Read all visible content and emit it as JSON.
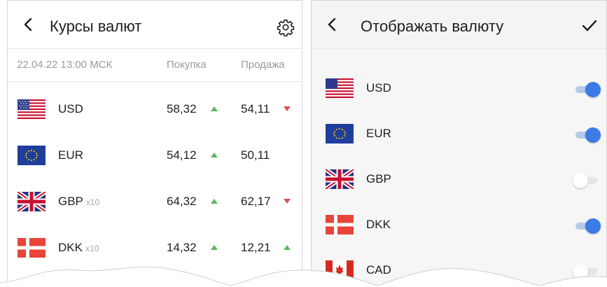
{
  "left": {
    "title": "Курсы валют",
    "date": "22.04.22 13:00 МСК",
    "col_buy": "Покупка",
    "col_sell": "Продажа",
    "back_icon": "chevron-left-icon",
    "settings_icon": "gear-icon",
    "rows": [
      {
        "code": "USD",
        "mult": "",
        "flag": "us-flag-icon",
        "buy": "58,32",
        "buy_trend": "up",
        "sell": "54,11",
        "sell_trend": "down"
      },
      {
        "code": "EUR",
        "mult": "",
        "flag": "eu-flag-icon",
        "buy": "54,12",
        "buy_trend": "up",
        "sell": "50,11",
        "sell_trend": "none"
      },
      {
        "code": "GBP",
        "mult": "x10",
        "flag": "uk-flag-icon",
        "buy": "64,32",
        "buy_trend": "up",
        "sell": "62,17",
        "sell_trend": "down"
      },
      {
        "code": "DKK",
        "mult": "x10",
        "flag": "dk-flag-icon",
        "buy": "14,32",
        "buy_trend": "up",
        "sell": "12,21",
        "sell_trend": "up"
      }
    ]
  },
  "right": {
    "title": "Отображать валюту",
    "back_icon": "chevron-left-icon",
    "confirm_icon": "checkmark-icon",
    "rows": [
      {
        "code": "USD",
        "flag": "us-flag-icon",
        "enabled": true
      },
      {
        "code": "EUR",
        "flag": "eu-flag-icon",
        "enabled": true
      },
      {
        "code": "GBP",
        "flag": "uk-flag-icon",
        "enabled": false
      },
      {
        "code": "DKK",
        "flag": "dk-flag-icon",
        "enabled": true
      },
      {
        "code": "CAD",
        "flag": "ca-flag-icon",
        "enabled": false
      }
    ]
  },
  "colors": {
    "up": "#5cb85c",
    "down": "#d9534f",
    "toggle_on": "#3b7be3",
    "toggle_off": "#ffffff"
  }
}
